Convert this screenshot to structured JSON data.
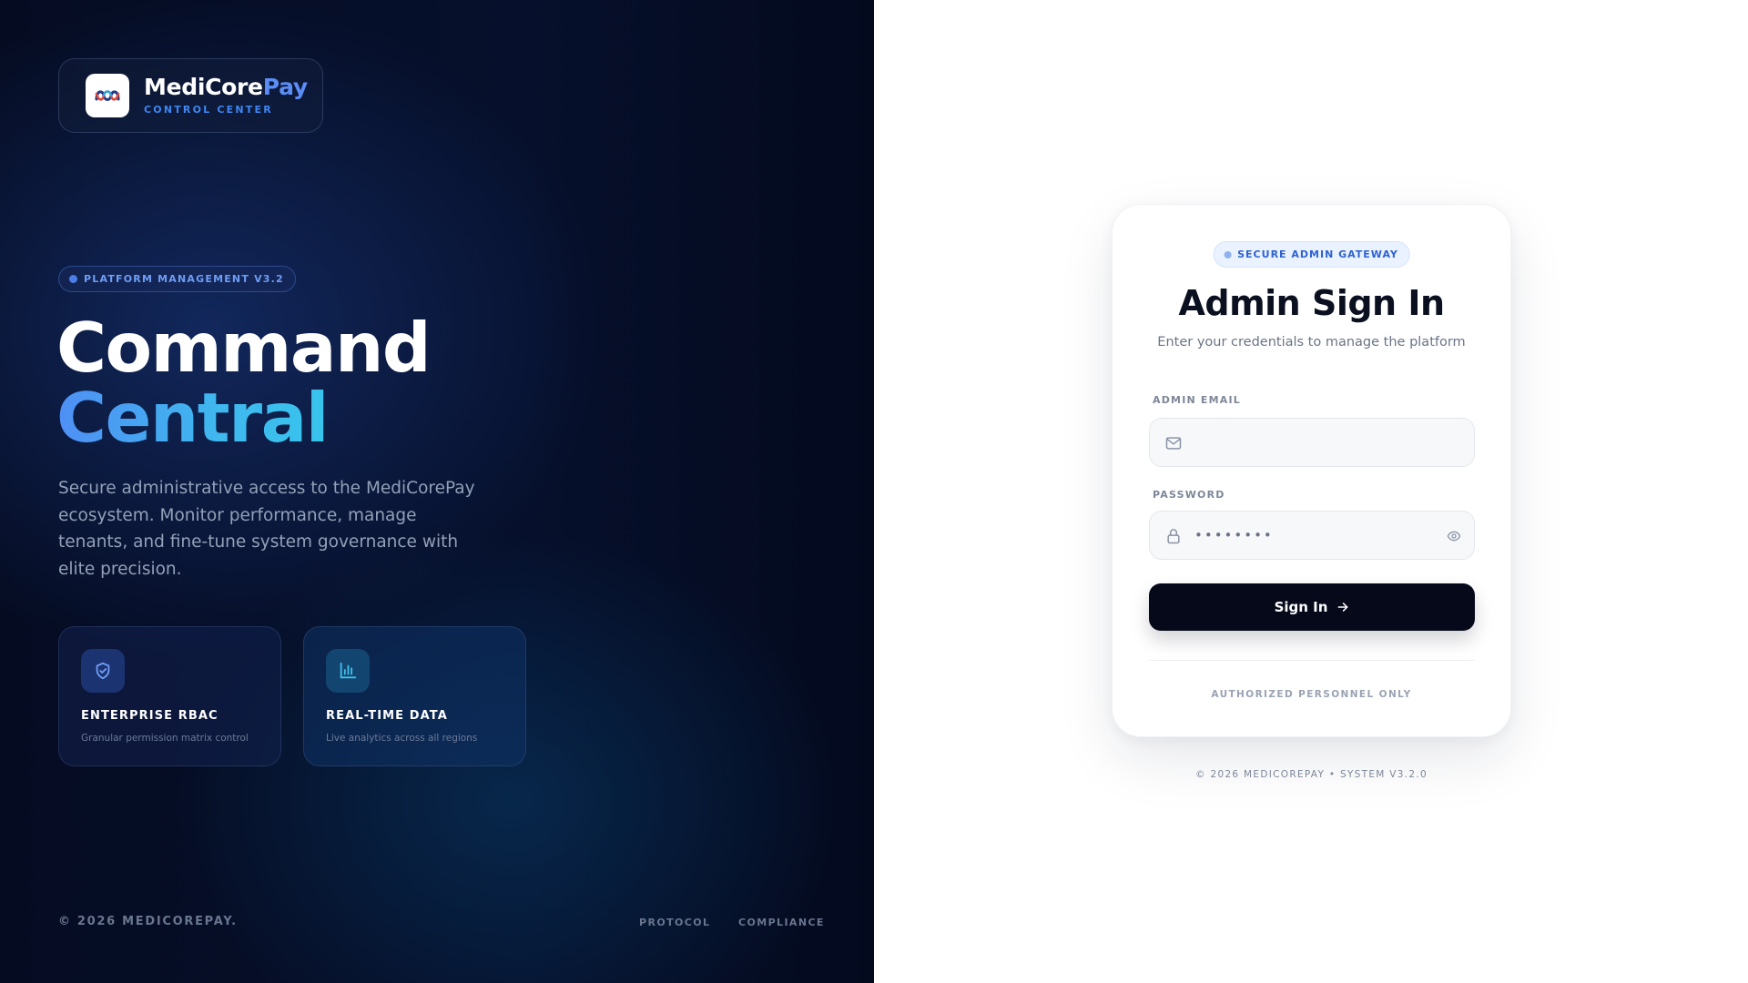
{
  "brand": {
    "name_main": "MediCore",
    "name_accent": "Pay",
    "subtitle": "CONTROL CENTER",
    "logo_icon": "medicorepay-logo-icon"
  },
  "hero": {
    "badge": "PLATFORM MANAGEMENT V3.2",
    "title_line1": "Command",
    "title_line2": "Central",
    "description": "Secure administrative access to the MediCorePay ecosystem. Monitor performance, manage tenants, and fine-tune system governance with elite precision."
  },
  "features": [
    {
      "icon": "shield-check-icon",
      "title": "ENTERPRISE RBAC",
      "subtitle": "Granular permission matrix control"
    },
    {
      "icon": "bar-chart-icon",
      "title": "REAL-TIME DATA",
      "subtitle": "Live analytics across all regions"
    }
  ],
  "left_footer": {
    "copyright": "© 2026 MEDICOREPAY.",
    "links": [
      "PROTOCOL",
      "COMPLIANCE"
    ]
  },
  "login": {
    "badge": "SECURE ADMIN GATEWAY",
    "title": "Admin Sign In",
    "subtitle": "Enter your credentials to manage the platform",
    "email_label": "ADMIN EMAIL",
    "email_value": "",
    "password_label": "PASSWORD",
    "password_masked": "••••••••",
    "signin_label": "Sign In",
    "authorized_note": "AUTHORIZED PERSONNEL ONLY"
  },
  "right_footer": "© 2026 MEDICOREPAY • SYSTEM V3.2.0",
  "colors": {
    "left_bg": "#050c22",
    "brand_accent": "#5b8df7",
    "hero_gradient_start": "#4f8ff5",
    "hero_gradient_end": "#38c4ec",
    "button_bg": "#05091a",
    "gateway_text": "#2d62d3"
  }
}
